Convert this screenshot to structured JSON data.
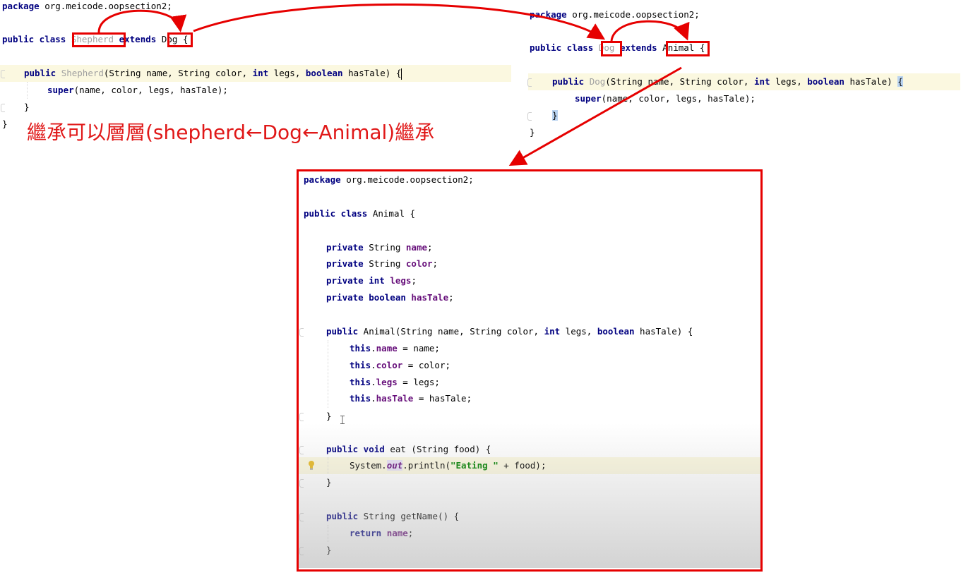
{
  "left_editor": {
    "lines": [
      {
        "kw": "package",
        "rest": " org.meicode.oopsection2;"
      },
      {
        "kw": "public class",
        "class_name": "Shepherd",
        "extends_kw": "extends",
        "parent": "Dog",
        "brace": " {"
      },
      {
        "kw": "public",
        "ctor": "Shepherd",
        "params_a": "(String name, String color, ",
        "kw2": "int",
        "params_b": " legs, ",
        "kw3": "boolean",
        "params_c": " hasTale) {"
      },
      {
        "kw": "super",
        "rest": "(name, color, legs, hasTale);"
      },
      {
        "rest": "}"
      },
      {
        "rest": "}"
      }
    ]
  },
  "right_editor": {
    "lines": [
      {
        "kw": "package",
        "rest": " org.meicode.oopsection2;"
      },
      {
        "kw": "public class",
        "class_name": "Dog",
        "extends_kw": "extends",
        "parent": "Animal",
        "brace": " {"
      },
      {
        "kw": "public",
        "ctor": "Dog",
        "params_a": "(String name, String color, ",
        "kw2": "int",
        "params_b": " legs, ",
        "kw3": "boolean",
        "params_c": " hasTale) ",
        "brace": "{"
      },
      {
        "kw": "super",
        "rest": "(name, color, legs, hasTale);"
      },
      {
        "rest": "}"
      },
      {
        "rest": "}"
      }
    ]
  },
  "annotation": "繼承可以層層(shepherd←Dog←Animal)繼承",
  "animal_editor": {
    "package_kw": "package",
    "package_rest": " org.meicode.oopsection2;",
    "class_kw": "public class",
    "class_rest": " Animal {",
    "fields": [
      {
        "kw": "private",
        "type": " String ",
        "name": "name",
        "end": ";"
      },
      {
        "kw": "private",
        "type": " String ",
        "name": "color",
        "end": ";"
      },
      {
        "kw": "private int",
        "type": " ",
        "name": "legs",
        "end": ";"
      },
      {
        "kw": "private boolean",
        "type": " ",
        "name": "hasTale",
        "end": ";"
      }
    ],
    "ctor": {
      "kw": "public",
      "a": " Animal(String name, String color, ",
      "kw2": "int",
      "b": " legs, ",
      "kw3": "boolean",
      "c": " hasTale) {"
    },
    "assigns": [
      {
        "kw": "this",
        "field": "name",
        "rest": " = name;"
      },
      {
        "kw": "this",
        "field": "color",
        "rest": " = color;"
      },
      {
        "kw": "this",
        "field": "legs",
        "rest": " = legs;"
      },
      {
        "kw": "this",
        "field": "hasTale",
        "rest": " = hasTale;"
      }
    ],
    "close1": "}",
    "eat": {
      "kw": "public void",
      "rest": " eat (String food) {"
    },
    "println": {
      "a": "System.",
      "field": "out",
      "b": ".println(",
      "str": "\"Eating \"",
      "c": " + food);"
    },
    "close2": "}",
    "getter": {
      "kw": "public",
      "rest": " String getName() {"
    },
    "ret": {
      "kw": "return",
      "field": "name",
      "end": ";"
    },
    "close3": "}"
  },
  "colors": {
    "annotation_red": "#e01818",
    "box_red": "#e60000",
    "keyword": "#000080",
    "field": "#660e7a",
    "string": "#008000",
    "unused": "#a0a0a0"
  },
  "icons": [
    "lightbulb-icon",
    "text-cursor-icon"
  ]
}
